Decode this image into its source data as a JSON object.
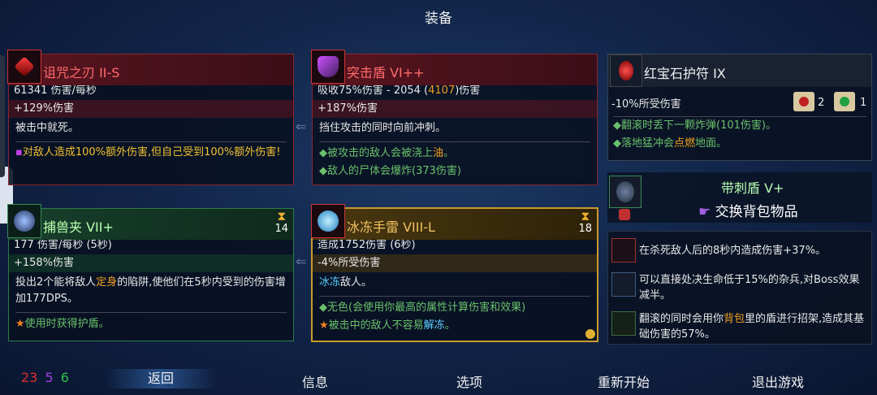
{
  "screen_title": "装备",
  "cards": {
    "curse_blade": {
      "name": "诅咒之刃  II-S",
      "dps": "61341 伤害/每秒",
      "bonus": "+129%伤害",
      "desc": "被击中就死。",
      "perk": "对敌人造成100%额外伤害,但自己受到100%额外伤害!"
    },
    "assault_shield": {
      "name": "突击盾  VI++",
      "absorb_prefix": "吸收75%伤害  -  2054 (",
      "absorb_hl": "4107",
      "absorb_suffix": ")伤害",
      "bonus": "+187%伤害",
      "desc": "挡住攻击的同时向前冲刺。",
      "perk1_prefix": "被攻击的敌人会被浇上",
      "perk1_hl": "油",
      "perk1_suffix": "。",
      "perk2": "敌人的尸体会爆炸(373伤害)"
    },
    "wolf_trap": {
      "name": "捕兽夹  VII+",
      "timer": "14",
      "dps": "177 伤害/每秒 (5秒)",
      "bonus": "+158%伤害",
      "desc_a": "投出2个能将敌人",
      "desc_hl": "定身",
      "desc_b": "的陷阱,使他们在5秒内受到的伤害增加177DPS。",
      "perk": "使用时获得护盾。"
    },
    "ice_grenade": {
      "name": "冰冻手雷  VIII-L",
      "timer": "18",
      "dmg": "造成1752伤害 (6秒)",
      "taken": "-4%所受伤害",
      "desc_hl": "冰冻",
      "desc_b": "敌人。",
      "perk1": "无色(会使用你最高的属性计算伤害和效果)",
      "perk2_a": "被击中的敌人不容易",
      "perk2_hl": "解冻",
      "perk2_b": "。"
    },
    "ruby_amulet": {
      "name": "红宝石护符  IX",
      "taken": "-10%所受伤害",
      "count1": "2",
      "count2": "1",
      "perk1": "翻滚时丢下一颗炸弹(101伤害)。",
      "perk2_a": "落地猛冲会",
      "perk2_hl": "点燃",
      "perk2_b": "地面。"
    },
    "spiked_shield": {
      "name": "带刺盾  V+",
      "swap": "交换背包物品"
    }
  },
  "mutations": [
    {
      "text": "在杀死敌人后的8秒内造成伤害+37%。",
      "icon": "sword-mutation-icon"
    },
    {
      "text": "可以直接处决生命低于15%的杂兵,对Boss效果减半。",
      "icon": "execute-mutation-icon"
    },
    {
      "text_a": "翻滚的同时会用你",
      "hl": "背包",
      "text_b": "里的盾进行招架,造成其基础伤害的57%。",
      "icon": "parry-mutation-icon"
    }
  ],
  "scrolls": {
    "brutality": "23",
    "tactics": "5",
    "survival": "6"
  },
  "nav": {
    "back": "返回",
    "info": "信息",
    "options": "选项",
    "restart": "重新开始",
    "quit": "退出游戏"
  },
  "colors": {
    "brutality": "#e03030",
    "tactics": "#a040e0",
    "survival": "#30c050"
  }
}
